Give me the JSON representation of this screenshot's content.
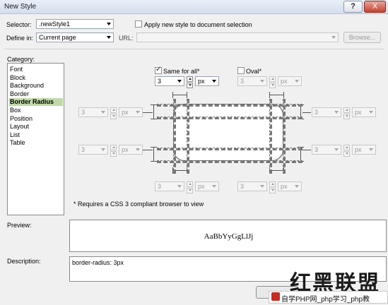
{
  "window": {
    "title": "New Style",
    "help_label": "?",
    "close_label": "X"
  },
  "form": {
    "selector_label": "Selector:",
    "selector_value": ".newStyle1",
    "apply_label": "Apply new style to document selection",
    "define_in_label": "Define in:",
    "define_in_value": "Current page",
    "url_label": "URL:",
    "browse_label": "Browse..."
  },
  "category": {
    "label": "Category:",
    "items": [
      "Font",
      "Block",
      "Background",
      "Border",
      "Border Radius",
      "Box",
      "Position",
      "Layout",
      "List",
      "Table"
    ],
    "selected": "Border Radius"
  },
  "radius": {
    "same_for_all_label": "Same for all*",
    "same_for_all_checked": true,
    "oval_label": "Oval*",
    "oval_checked": false,
    "value": "3",
    "unit": "px",
    "note": "* Requires a CSS 3 compliant browser to view"
  },
  "preview": {
    "label": "Preview:",
    "sample_text": "AaBbYyGgLlJj"
  },
  "description": {
    "label": "Description:",
    "text": "border-radius: 3px"
  },
  "watermark": {
    "logo_text": "红黑联盟",
    "bar_text": "自学PHP网_php学习_php教"
  },
  "colors": {
    "selected_category": "#c0d9a8",
    "close_button": "#c4412d"
  }
}
